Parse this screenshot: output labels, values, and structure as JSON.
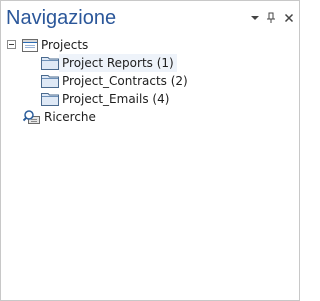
{
  "panel": {
    "title": "Navigazione"
  },
  "header_buttons": [
    {
      "name": "dropdown-arrow-icon"
    },
    {
      "name": "pin-icon"
    },
    {
      "name": "close-icon"
    }
  ],
  "tree": {
    "root": {
      "label": "Projects",
      "expanded": true,
      "icon": "project-folder-icon",
      "children": [
        {
          "label": "Project Reports (1)",
          "icon": "folder-icon"
        },
        {
          "label": "Project_Contracts (2)",
          "icon": "folder-icon"
        },
        {
          "label": "Project_Emails (4)",
          "icon": "folder-icon"
        }
      ]
    },
    "searches": {
      "label": "Ricerche",
      "icon": "search-folder-icon"
    }
  },
  "colors": {
    "title": "#2b579a",
    "text": "#1e1e1e",
    "border": "#c8c8c8"
  }
}
